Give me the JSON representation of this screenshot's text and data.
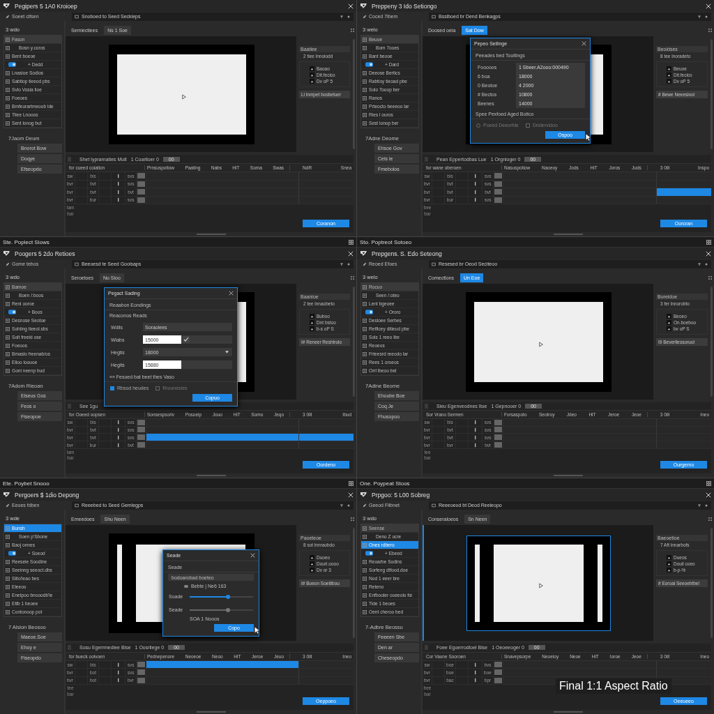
{
  "panels": [
    {
      "title": "Pegipers 5 1A0 Kroioep",
      "filter": "Soeet cifsen",
      "path": "Snoboed to Seed Seckieps",
      "tabs": [
        {
          "label": "Semiectiees",
          "selected": false
        },
        {
          "label": "Ns 1 Soe",
          "selected": false
        }
      ],
      "library_title": "3 wdo",
      "items": [
        {
          "kind": "item",
          "label": "Fason",
          "selected": false
        },
        {
          "kind": "sub",
          "label": "Bosn y.coros",
          "selected": false
        },
        {
          "kind": "item",
          "label": "Bent boeoe",
          "selected": false
        },
        {
          "kind": "toggle",
          "label": "+ Dedd",
          "on": true,
          "selected": false
        },
        {
          "kind": "item",
          "label": "Lnasioe Sodios",
          "selected": false
        },
        {
          "kind": "item",
          "label": "Sabtiop tieeod pbs",
          "selected": false
        },
        {
          "kind": "item",
          "label": "Svlo Vosia lioe",
          "selected": false
        },
        {
          "kind": "item",
          "label": "Foeoes",
          "selected": false
        },
        {
          "kind": "item",
          "label": "Bmfeorartmeoob lde",
          "selected": false
        },
        {
          "kind": "item",
          "label": "Tiiee Lnooos",
          "selected": false
        },
        {
          "kind": "item",
          "label": "Sent lonog but",
          "selected": false
        }
      ],
      "actions_title": "7Jaom Deum",
      "actions": [
        "Bnorot Bow",
        "Doqye",
        "Efseopdo"
      ],
      "preview": {
        "kind": "wide",
        "selected": false
      },
      "inspector": {
        "title": "Baatiee",
        "subtitle": "2 tiee lnnoiodd",
        "rows": [
          "Baoao",
          "Dit.fecico",
          "Dv oP 5"
        ],
        "button": "Ll lnmpet bosbetuer"
      },
      "timeline": {
        "checked": false,
        "title": "Shet lyprarnaties Mult",
        "count": "1 Coarlioer 0",
        "chip": "00",
        "columns": [
          "for cueed coiation",
          "Prnsuspotiow",
          "Paating",
          "Nabs",
          "HiT",
          "Soma",
          "Swas"
        ],
        "end_columns": [
          "NdR",
          "Snea"
        ],
        "rows": [
          {
            "cells": [
              "sw",
              "bis",
              "svs"
            ],
            "segments": [
              {
                "selected": false
              },
              {
                "selected": false
              }
            ]
          },
          {
            "cells": [
              "bvr",
              "bvt",
              "svs"
            ],
            "segments": [
              {
                "selected": false
              },
              {
                "selected": false
              }
            ]
          },
          {
            "cells": [
              "bvr",
              "bvt",
              "bvt"
            ],
            "segments": [
              {
                "selected": false
              },
              {
                "selected": false
              }
            ]
          },
          {
            "cells": [
              "bvr",
              "bur",
              "svs"
            ],
            "segments": [
              {
                "selected": false
              },
              {
                "selected": false
              }
            ]
          }
        ],
        "extra": [
          "tam",
          "bar"
        ],
        "button": "Coranon"
      }
    },
    {
      "title": "Preppeny 3 Ido Setiongo",
      "filter": "Coced 7ibem",
      "path": "Bssiboed br Dend Benkagps",
      "tabs": [
        {
          "label": "Doosed oeia",
          "selected": false
        },
        {
          "label": "Sat Dow",
          "selected": true
        }
      ],
      "library_title": "3 welo",
      "items": [
        {
          "kind": "item",
          "label": "Beuoe",
          "selected": false
        },
        {
          "kind": "sub",
          "label": "Bom 7ooes",
          "selected": false
        },
        {
          "kind": "item",
          "label": "Bant beooe",
          "selected": false
        },
        {
          "kind": "toggle",
          "label": "+ Dard",
          "on": true,
          "selected": false
        },
        {
          "kind": "item",
          "label": "Deeose Bertics",
          "selected": false
        },
        {
          "kind": "item",
          "label": "Rabtioy tieoad pbe",
          "selected": false
        },
        {
          "kind": "item",
          "label": "Solo Tooop ber",
          "selected": false
        },
        {
          "kind": "item",
          "label": "Ranos",
          "selected": false
        },
        {
          "kind": "item",
          "label": "Prteocto beeeoo lar",
          "selected": false
        },
        {
          "kind": "item",
          "label": "Ries l ouros",
          "selected": false
        },
        {
          "kind": "item",
          "label": "Sest lonop ber",
          "selected": false
        }
      ],
      "actions_title": "7Adne Deome",
      "actions": [
        "Ehsoe Gov",
        "Ceis ie",
        "Fmebolos"
      ],
      "preview": {
        "kind": "wide",
        "selected": false
      },
      "inspector": {
        "title": "Beoidses",
        "subtitle": "8 tee lnoradeto",
        "rows": [
          "Beuoe",
          "Dit.fecico",
          "Dv oP 5"
        ],
        "button": "# Bewe Neeesivol"
      },
      "timeline": {
        "checked": false,
        "title": "Pean Eppertodbas Lue",
        "count": "1 Orgnioger 0",
        "chip": "00",
        "columns": [
          "for wane oberoen",
          "Nasuspotiow",
          "Naoeoy",
          "Jods",
          "HiT",
          "Joros",
          "Juds"
        ],
        "end_columns": [
          "3 0ill",
          "Inspo"
        ],
        "rows": [
          {
            "cells": [
              "sw",
              "bis",
              "svs"
            ],
            "segments": [
              {
                "selected": false
              },
              {
                "selected": false
              }
            ]
          },
          {
            "cells": [
              "bvr",
              "bvt",
              "svs"
            ],
            "segments": [
              {
                "selected": false
              },
              {
                "selected": false
              }
            ]
          },
          {
            "cells": [
              "bvr",
              "bvt",
              "bvt"
            ],
            "segments": [
              {
                "selected": false
              },
              {
                "selected": true
              }
            ]
          },
          {
            "cells": [
              "bvr",
              "bur",
              "svs"
            ],
            "segments": [
              {
                "selected": false
              },
              {
                "selected": false
              }
            ]
          }
        ],
        "extra": [
          "bee",
          "bar"
        ],
        "button": "Oorcran"
      },
      "dialog": {
        "kind": "table",
        "title": "Pepeo Seilinge",
        "subtitle": "Peeades bed Tooitings",
        "rows": [
          {
            "label": "Fooooos",
            "value": "1 Sbeer.A2ooo:000490"
          },
          {
            "label": "6 boa",
            "value": "18000"
          },
          {
            "label": "0 Beotoe",
            "value": "4 2000"
          },
          {
            "label": "# Bectos",
            "value": "10800"
          },
          {
            "label": "Beenes",
            "value": "14000"
          }
        ],
        "note": "Spee Pexfoed Aged Botico",
        "options": [
          {
            "kind": "radio",
            "label": "Poeed Deeorfde",
            "checked": false
          },
          {
            "kind": "checkbox",
            "label": "Dridervidoo",
            "checked": false
          }
        ],
        "button": "Ospoo"
      }
    },
    {
      "topbar": "Ste. Poplect Slows",
      "title": "Poogers 5 2do Retioes",
      "filter": "Gome tebos",
      "path": "Beeoesd te Seed Goolsaps",
      "tabs": [
        {
          "label": "Seroetoes",
          "selected": false
        },
        {
          "label": "Nu Sioo",
          "selected": false
        }
      ],
      "library_title": "3 wdo",
      "items": [
        {
          "kind": "item",
          "label": "Bamoe",
          "selected": false
        },
        {
          "kind": "sub",
          "label": "Boen /:boos",
          "selected": false
        },
        {
          "kind": "item",
          "label": "Reni ooroe",
          "selected": false
        },
        {
          "kind": "toggle",
          "label": "+ Boos",
          "on": true,
          "selected": false
        },
        {
          "kind": "item",
          "label": "Desnose Seotoe",
          "selected": false
        },
        {
          "kind": "item",
          "label": "Sohiing tieeol.sbs",
          "selected": false
        },
        {
          "kind": "item",
          "label": "Solt freeid ose",
          "selected": false
        },
        {
          "kind": "item",
          "label": "Foeoos",
          "selected": false
        },
        {
          "kind": "item",
          "label": "Bmaslo freenab/os",
          "selected": false
        },
        {
          "kind": "item",
          "label": "Elioo loouoe",
          "selected": false
        },
        {
          "kind": "item",
          "label": "Goni neenp bud",
          "selected": false
        }
      ],
      "actions_title": "7Adom Rieoan",
      "actions": [
        "Elseus Gos",
        "Feos o",
        "Fiseopoe"
      ],
      "preview": {
        "kind": "wide",
        "selected": false
      },
      "inspector": {
        "title": "Baanioe",
        "subtitle": "2 tee lnnaobeto",
        "rows": [
          "Buboo",
          "Dnt bstoo",
          "b-s oP S"
        ],
        "button": "I# Reneer Reshtrolo"
      },
      "timeline": {
        "checked": false,
        "title": "See 1gu",
        "columns": [
          "for Ooeed oopsen",
          "Sonsespsoriv",
          "Posoeip",
          "Jouo",
          "HiT",
          "Somo",
          "Jeqo"
        ],
        "end_columns": [
          "3 0ill",
          "Ibud"
        ],
        "rows": [
          {
            "cells": [
              "sw",
              "bis",
              "svs"
            ],
            "segments": [
              {
                "selected": false
              },
              {
                "selected": false
              }
            ]
          },
          {
            "cells": [
              "bvr",
              "bvt",
              "svs"
            ],
            "segments": [
              {
                "selected": false
              },
              {
                "selected": false
              }
            ]
          },
          {
            "cells": [
              "bvr",
              "bvt",
              "svs"
            ],
            "segments": [
              {
                "selected": true
              },
              {
                "selected": true
              }
            ]
          },
          {
            "cells": [
              "bvr",
              "bur",
              "bvt"
            ],
            "segments": [
              {
                "selected": false
              },
              {
                "selected": false
              }
            ]
          }
        ],
        "extra": [
          "tam",
          "bar"
        ],
        "button": "Oordeno"
      },
      "dialog": {
        "kind": "form",
        "title": "Pegact Sading",
        "subtitle": "Reaabon Eondings",
        "section": "Reaconos Reads",
        "fields": [
          {
            "kind": "readonly",
            "label": "Wdlis",
            "value": "Soraolees"
          },
          {
            "kind": "confirm",
            "label": "Wlabs",
            "value": "15000"
          },
          {
            "kind": "select",
            "label": "Hegtis",
            "value": "18000"
          },
          {
            "kind": "input",
            "label": "Hegits",
            "value": "15880"
          }
        ],
        "note": "«« Fesoed bat beet thes Vaso",
        "options": [
          {
            "kind": "checkbox",
            "label": "Rbsod heudes",
            "checked": true
          },
          {
            "kind": "checkbox",
            "label": "Rroonesles",
            "checked": false
          }
        ],
        "button": "Copuo"
      }
    },
    {
      "topbar": "Sto. Poptreot Sotoeo",
      "title": "Prepgens. S. Edo Seteong",
      "filter": "Reoed Efoes",
      "path": "Resesed br Oeod Seciteoo",
      "tabs": [
        {
          "label": "Comectlons",
          "selected": false
        },
        {
          "label": "Un Eoe",
          "selected": true
        }
      ],
      "library_title": "3 welo",
      "items": [
        {
          "kind": "item",
          "label": "Rocuo",
          "selected": false
        },
        {
          "kind": "sub",
          "label": "Seen /:oteo",
          "selected": false
        },
        {
          "kind": "item",
          "label": "Lent bgeoee",
          "selected": false
        },
        {
          "kind": "toggle",
          "label": "+ Ororo",
          "on": true,
          "selected": false
        },
        {
          "kind": "item",
          "label": "Desloee Serbes",
          "selected": false
        },
        {
          "kind": "item",
          "label": "Retficey ditieud pbe",
          "selected": false
        },
        {
          "kind": "item",
          "label": "Sols 1 reeo lbe",
          "selected": false
        },
        {
          "kind": "item",
          "label": "Reoeos",
          "selected": false
        },
        {
          "kind": "item",
          "label": "Frteesrd reeodo lar",
          "selected": false
        },
        {
          "kind": "item",
          "label": "Rees 1 oroeos",
          "selected": false
        },
        {
          "kind": "item",
          "label": "Orrl lbeoo bel",
          "selected": false
        }
      ],
      "actions_title": "7Adine Beome",
      "actions": [
        "Ehoube Boe",
        "Coq Je",
        "Fhusopoo"
      ],
      "preview": {
        "kind": "wide",
        "selected": false
      },
      "inspector": {
        "title": "Boreidoe",
        "subtitle": "3 fer lnnorobto",
        "rows": [
          "Beoeo",
          "On.boeboo",
          "bv oP S"
        ],
        "button": "I9 Beverlleosoruol"
      },
      "timeline": {
        "checked": false,
        "title": "Sieu Egenveodnes Itoe",
        "count": "1 Gepnooer 0",
        "chip": "00",
        "columns": [
          "Sor Vrano Sermen",
          "Forsaspoto",
          "Seotroy",
          "Jdeo",
          "HiT",
          "Jeroe",
          "Jeoe"
        ],
        "end_columns": [
          "3 0ill",
          "Ineo"
        ],
        "rows": [
          {
            "cells": [
              "sw",
              "bis",
              "svs"
            ],
            "segments": [
              {
                "selected": false
              },
              {
                "selected": false
              }
            ]
          },
          {
            "cells": [
              "bvr",
              "bvt",
              "svs"
            ],
            "segments": [
              {
                "selected": false
              },
              {
                "selected": false
              }
            ]
          },
          {
            "cells": [
              "bvr",
              "bvt",
              "svs"
            ],
            "segments": [
              {
                "selected": false
              },
              {
                "selected": false
              }
            ]
          },
          {
            "cells": [
              "bvr",
              "bvr",
              "bvt"
            ],
            "segments": [
              {
                "selected": false
              },
              {
                "selected": false
              }
            ]
          }
        ],
        "extra": [
          "tee",
          "bar"
        ],
        "button": "Ourgerno"
      }
    },
    {
      "topbar": "Ete. Poybet Snooo",
      "title": "Pergoers $ 1dio Depong",
      "filter": "Eeoes fdben",
      "path": "Reeebed to Seed Gemlegps",
      "tabs": [
        {
          "label": "Emeedoes",
          "selected": false
        },
        {
          "label": "Shu Neen",
          "selected": false
        }
      ],
      "library_title": "3 wde",
      "items": [
        {
          "kind": "item",
          "label": "Bunsh",
          "selected": true
        },
        {
          "kind": "sub",
          "label": "Soen p'Sbone",
          "selected": false
        },
        {
          "kind": "item",
          "label": "Baoj onnes",
          "selected": false
        },
        {
          "kind": "toggle",
          "label": "+ Soeod",
          "on": true,
          "selected": false
        },
        {
          "kind": "item",
          "label": "Reeseie Soodine",
          "selected": false
        },
        {
          "kind": "item",
          "label": "Seeinng seeoct.dbs",
          "selected": false
        },
        {
          "kind": "item",
          "label": "Sitio'ieao bes",
          "selected": false
        },
        {
          "kind": "item",
          "label": "Eleeoo",
          "selected": false
        },
        {
          "kind": "item",
          "label": "Enetpoo bnooodb'ie",
          "selected": false
        },
        {
          "kind": "item",
          "label": "Ettb 1 beoee",
          "selected": false
        },
        {
          "kind": "item",
          "label": "Contonoop pot",
          "selected": false
        }
      ],
      "actions_title": "7 Alsion Beosoo",
      "actions": [
        "Maeoe.Soe",
        "Ehoy e",
        "Fiseopdo"
      ],
      "preview": {
        "kind": "bars",
        "selected": false
      },
      "inspector": {
        "title": "Paoeteoe",
        "subtitle": "8 sot lnnraobdo",
        "rows": [
          "Duoeo",
          "Dourl.oooo",
          "Dv or 3"
        ],
        "button": "I# Boeon Soeitibou"
      },
      "timeline": {
        "checked": false,
        "title": "Sosu Egerrmediee Bise",
        "count": "1 Oosrliege 0",
        "chip": "00",
        "columns": [
          "for bueck ooivoen",
          "Pednepenore",
          "Neoeoe",
          "Neoo",
          "HiT",
          "Jeroe",
          "Jeuo"
        ],
        "end_columns": [
          "3 0ill",
          "Ineo"
        ],
        "rows": [
          {
            "cells": [
              "sw",
              "bis",
              "svs"
            ],
            "segments": [
              {
                "selected": true
              },
              {
                "selected": false
              }
            ]
          },
          {
            "cells": [
              "bvr",
              "bot",
              "svs"
            ],
            "segments": [
              {
                "selected": false
              },
              {
                "selected": false
              }
            ]
          },
          {
            "cells": [
              "bvr",
              "bot",
              "bvr"
            ],
            "segments": [
              {
                "selected": false
              },
              {
                "selected": false
              }
            ]
          }
        ],
        "extra": [
          "tee",
          "bar"
        ],
        "button": "Oeppoeo"
      },
      "dialog": {
        "kind": "slider",
        "title": "Seade",
        "subtitle": "Seade",
        "field": "bodoarobad boeteo",
        "info": "Bebte | Ne6 163",
        "sliders": [
          {
            "label": "Soade",
            "level": 0.6,
            "active": true
          },
          {
            "label": "Seade",
            "level": 0.6,
            "active": false
          }
        ],
        "readout": "SOA 1 Nooos",
        "button": "Copo"
      }
    },
    {
      "topbar": "One. Poypeat Stoos",
      "title": "Prpgoo: 5 L00 Sobreg",
      "filter": "Geeod Fiibnet",
      "path": "Reeeoeod bt Deod Reeleopo",
      "tabs": [
        {
          "label": "Conseraloeos",
          "selected": false
        },
        {
          "label": "Sn Neen",
          "selected": false
        }
      ],
      "library_title": "3 wdo",
      "items": [
        {
          "kind": "item",
          "label": "Seense",
          "selected": false
        },
        {
          "kind": "sub",
          "label": "Deno Z ocre",
          "selected": false
        },
        {
          "kind": "item",
          "label": "Ones rdbero",
          "selected": true
        },
        {
          "kind": "toggle",
          "label": "+ Ebeed",
          "on": true,
          "selected": false
        },
        {
          "kind": "item",
          "label": "Reoarbe Sodins",
          "selected": false
        },
        {
          "kind": "item",
          "label": "Sorfeng dtfood.doe",
          "selected": false
        },
        {
          "kind": "item",
          "label": "Nod 1 eeer bre",
          "selected": false
        },
        {
          "kind": "item",
          "label": "Reteno",
          "selected": false
        },
        {
          "kind": "item",
          "label": "Enfbooler ooeeolo lte",
          "selected": false
        },
        {
          "kind": "item",
          "label": "Tide 1 beoes",
          "selected": false
        },
        {
          "kind": "item",
          "label": "Oent cheroo bed",
          "selected": false
        }
      ],
      "actions_title": "7-Adbre Beossu",
      "actions": [
        "Feeeen Sbe",
        "Den ar",
        "Cheseopdo"
      ],
      "preview": {
        "kind": "square",
        "selected": true
      },
      "inspector": {
        "title": "Baeoetioe",
        "subtitle": "7 Aft lnnarbofs",
        "rows": [
          "Dueos",
          "Douil coeo",
          "b-p-%"
        ],
        "button": "# Eoroal Seeoetrlbel"
      },
      "timeline": {
        "checked": false,
        "title": "Foee Egoerrodloel Bise",
        "count": "1 Oeoeeoger 0",
        "chip": "00",
        "columns": [
          "Cor Vaune Sooroen",
          "Snavepsorpe",
          "Neoeioy",
          "Neoe",
          "HiT",
          "Ioroe",
          "Jeoe"
        ],
        "end_columns": [
          "3 0ill",
          "Ineo"
        ],
        "rows": [
          {
            "cells": [
              "sw",
              "boe",
              "bvs"
            ],
            "segments": [
              {
                "selected": false
              },
              {
                "selected": false
              }
            ]
          },
          {
            "cells": [
              "bvr",
              "boe",
              "boe"
            ],
            "segments": [
              {
                "selected": false
              },
              {
                "selected": false
              }
            ]
          },
          {
            "cells": [
              "bvr",
              "bac",
              "bpr"
            ],
            "segments": [
              {
                "selected": false
              },
              {
                "selected": false
              }
            ]
          }
        ],
        "extra": [
          "bee",
          "bar"
        ],
        "button": "Oeeueeo"
      },
      "caption": "Final 1:1 Aspect Ratio"
    }
  ]
}
